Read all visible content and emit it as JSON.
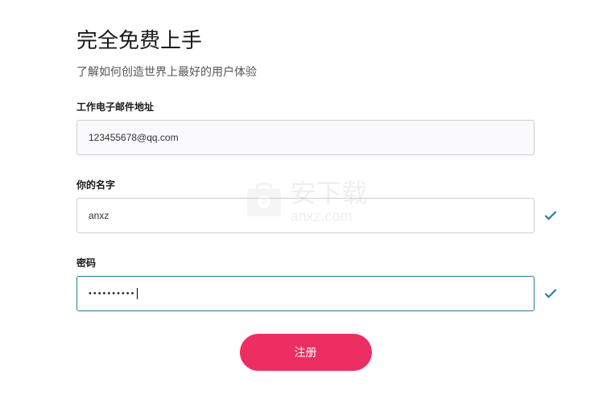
{
  "heading": "完全免费上手",
  "subheading": "了解如何创造世界上最好的用户体验",
  "form": {
    "email": {
      "label": "工作电子邮件地址",
      "value": "123455678@qq.com"
    },
    "name": {
      "label": "你的名字",
      "value": "anxz"
    },
    "password": {
      "label": "密码",
      "value": "••••••••••"
    },
    "submit": "注册"
  },
  "watermark": {
    "title": "安下载",
    "domain": "anxz.com"
  }
}
